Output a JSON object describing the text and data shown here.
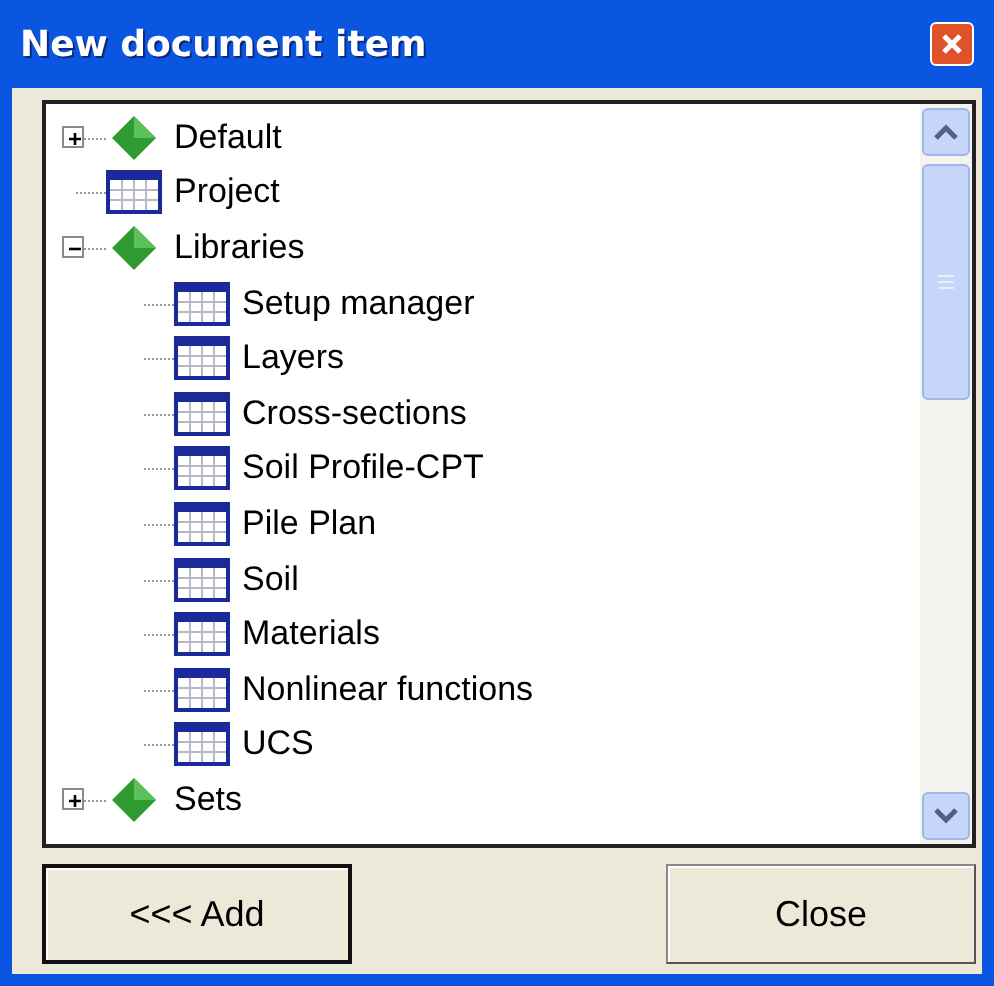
{
  "window": {
    "title": "New document item"
  },
  "tree": [
    {
      "label": "Default",
      "kind": "folder",
      "expanded": false
    },
    {
      "label": "Project",
      "kind": "table"
    },
    {
      "label": "Libraries",
      "kind": "folder",
      "expanded": true,
      "children": [
        {
          "label": "Setup manager",
          "kind": "table"
        },
        {
          "label": "Layers",
          "kind": "table"
        },
        {
          "label": "Cross-sections",
          "kind": "table"
        },
        {
          "label": "Soil Profile-CPT",
          "kind": "table"
        },
        {
          "label": "Pile Plan",
          "kind": "table"
        },
        {
          "label": "Soil",
          "kind": "table"
        },
        {
          "label": "Materials",
          "kind": "table"
        },
        {
          "label": "Nonlinear functions",
          "kind": "table"
        },
        {
          "label": "UCS",
          "kind": "table"
        }
      ]
    },
    {
      "label": "Sets",
      "kind": "folder",
      "expanded": false
    }
  ],
  "buttons": [
    {
      "label": "<<< Add",
      "default": true
    },
    {
      "label": "Close",
      "default": false
    }
  ]
}
